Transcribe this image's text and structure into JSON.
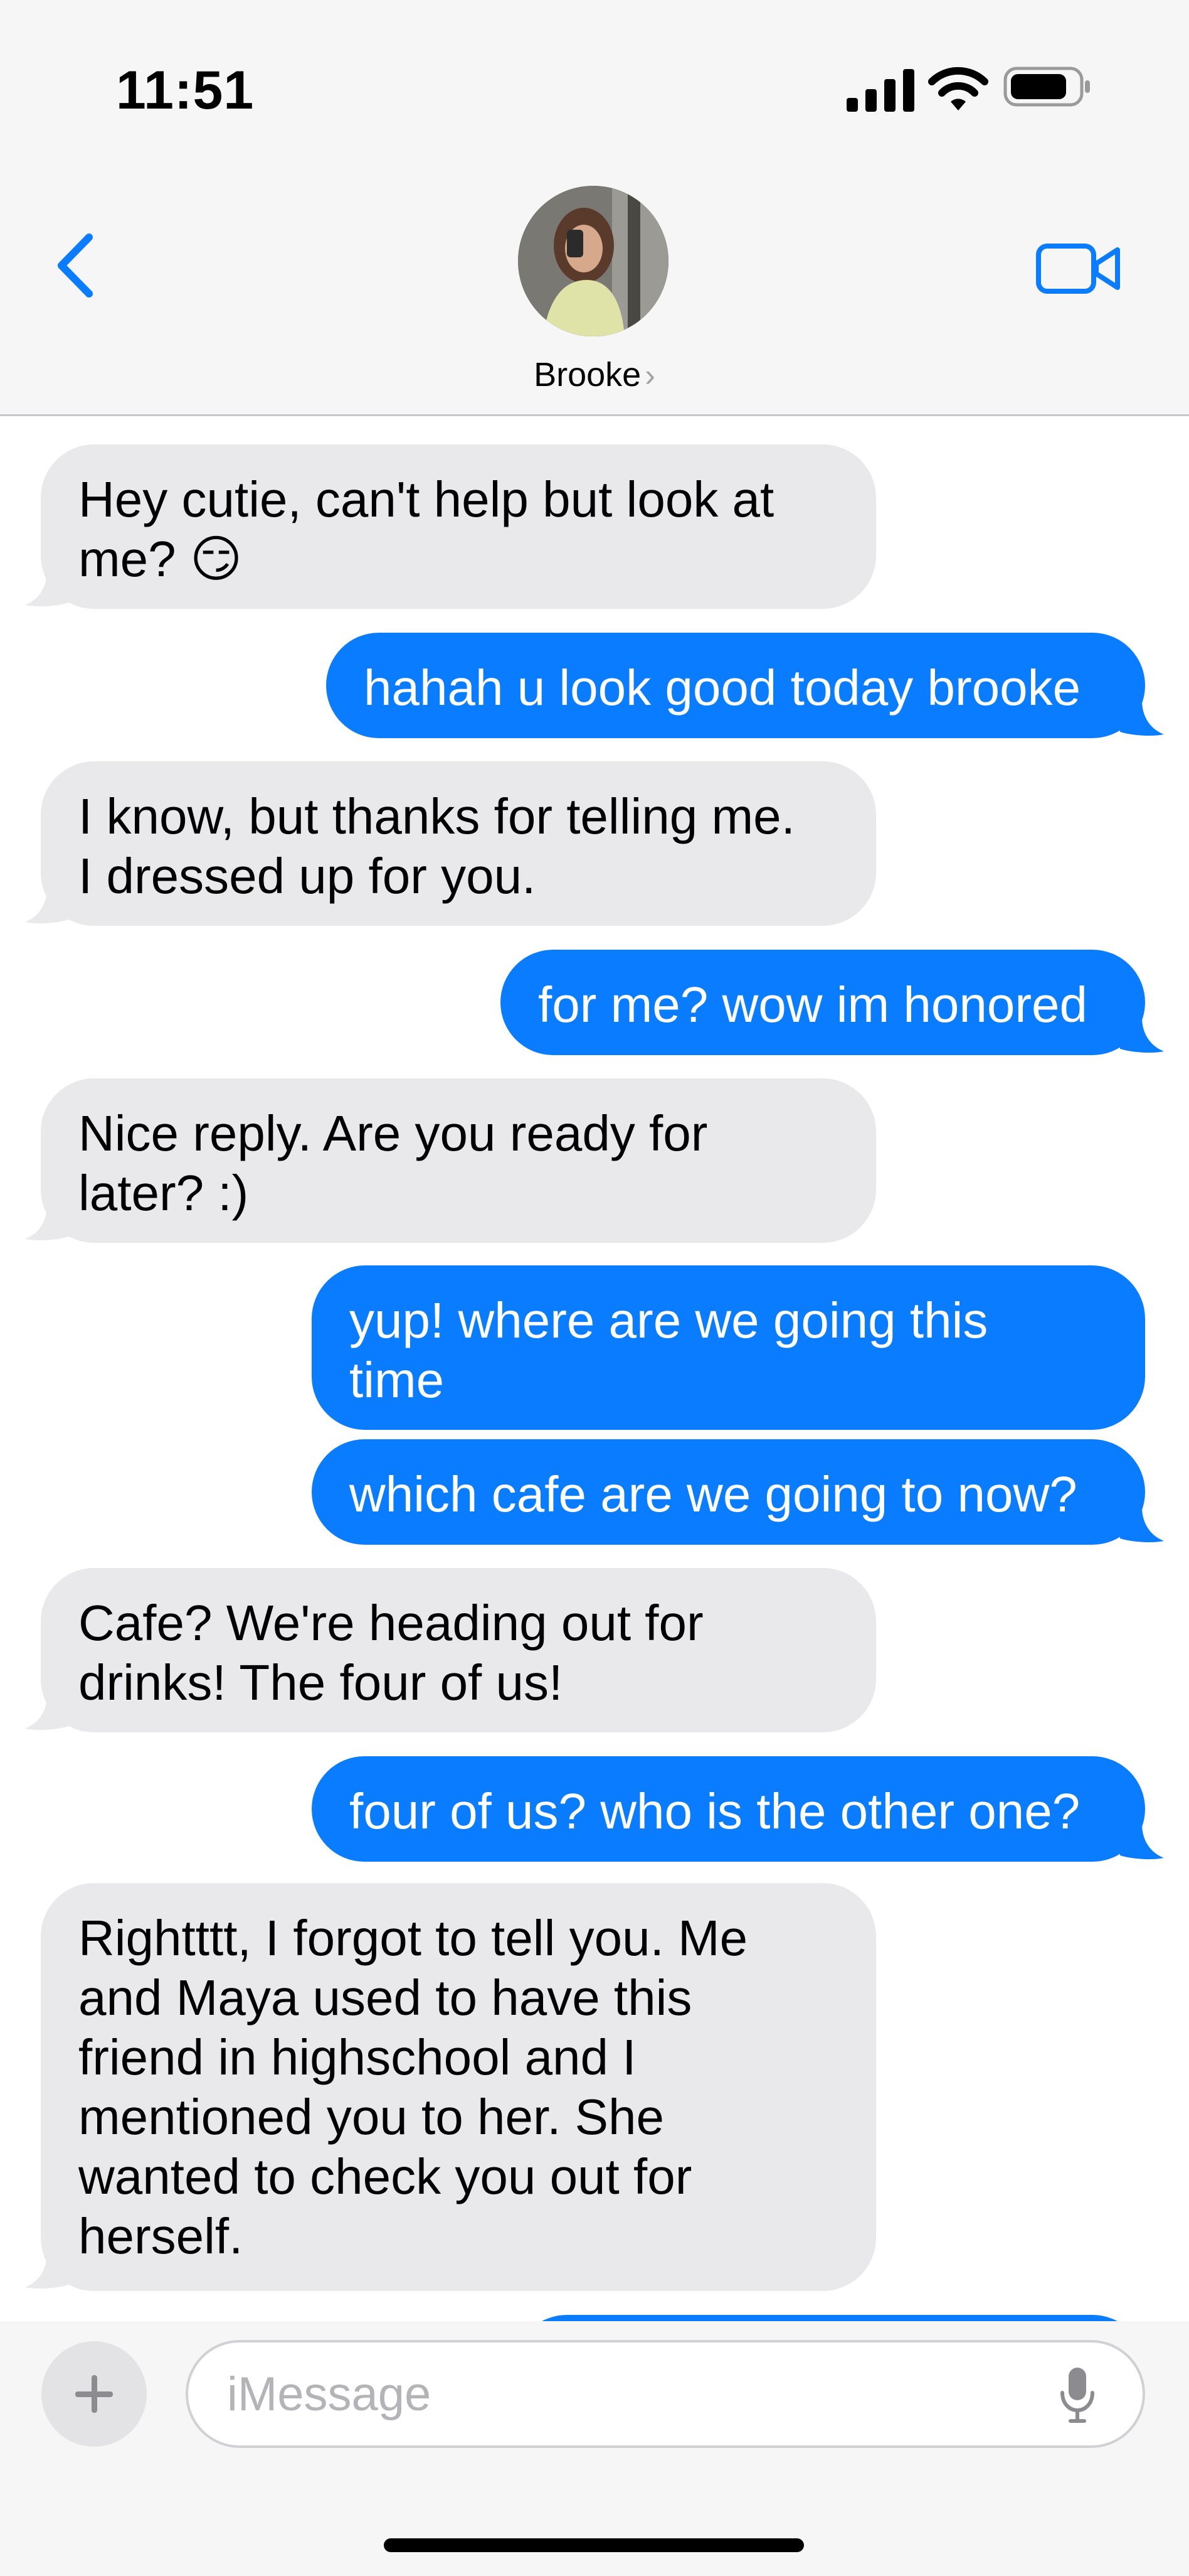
{
  "status_bar": {
    "time": "11:51"
  },
  "header": {
    "contact_name": "Brooke",
    "chevron": "›"
  },
  "messages": [
    {
      "dir": "in",
      "lines": [
        "Hey cutie, can't help but look at",
        "me? 😏"
      ]
    },
    {
      "dir": "out",
      "lines": [
        "hahah u look good today brooke"
      ]
    },
    {
      "dir": "in",
      "lines": [
        "I know, but thanks for telling me.",
        "I dressed up for you."
      ]
    },
    {
      "dir": "out",
      "lines": [
        "for me? wow im honored"
      ]
    },
    {
      "dir": "in",
      "lines": [
        "Nice reply. Are you ready for",
        "later? :)"
      ]
    },
    {
      "dir": "out",
      "lines": [
        "yup! where are we going this",
        "time"
      ]
    },
    {
      "dir": "out",
      "lines": [
        "which cafe are we going to now?"
      ]
    },
    {
      "dir": "in",
      "lines": [
        "Cafe? We're heading out for",
        "drinks! The four of us!"
      ]
    },
    {
      "dir": "out",
      "lines": [
        "four of us? who is the other one?"
      ]
    },
    {
      "dir": "in",
      "lines": [
        "Rightttt, I forgot to tell you. Me",
        "and Maya used to have this",
        "friend in highschool and I",
        "mentioned you to her. She",
        "wanted to check you out for",
        "herself."
      ]
    }
  ],
  "composer": {
    "placeholder": "iMessage"
  },
  "colors": {
    "incoming": "#e9e9eb",
    "outgoing": "#0a7cff",
    "accent": "#0a7cff"
  },
  "icons": [
    "back-chevron-icon",
    "video-call-icon",
    "plus-icon",
    "microphone-icon",
    "cellular-signal-icon",
    "wifi-icon",
    "battery-icon"
  ]
}
